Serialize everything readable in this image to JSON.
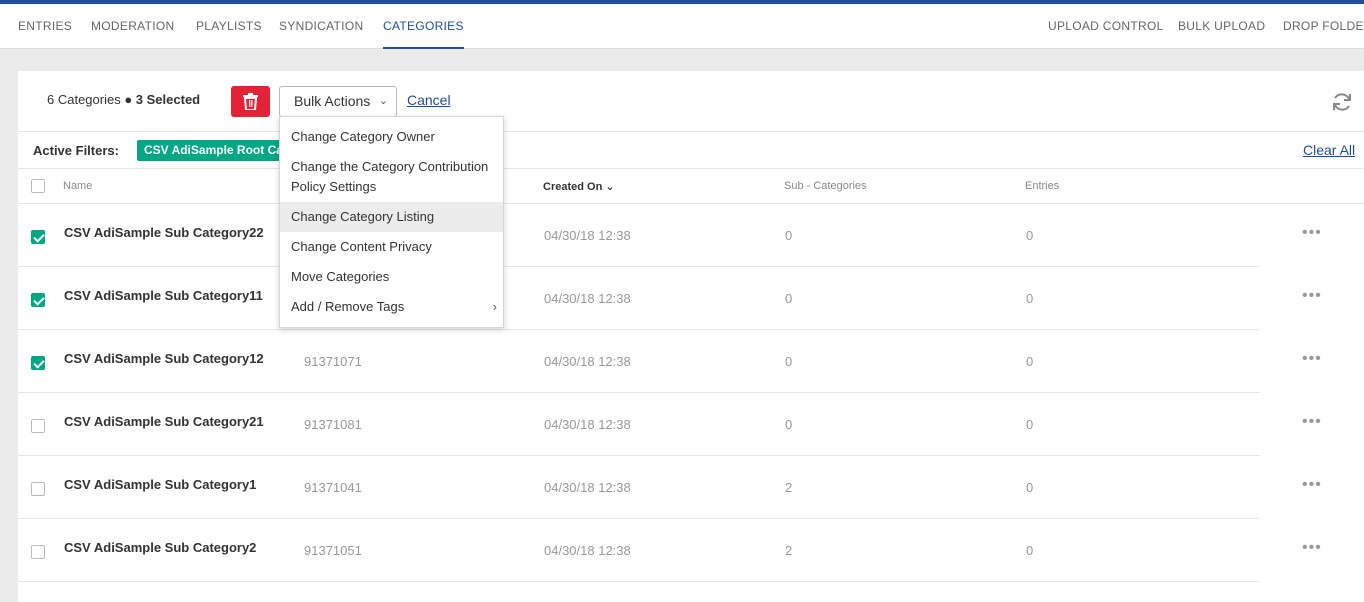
{
  "nav": {
    "left": [
      "ENTRIES",
      "MODERATION",
      "PLAYLISTS",
      "SYNDICATION",
      "CATEGORIES"
    ],
    "right": [
      "UPLOAD CONTROL",
      "BULK UPLOAD",
      "DROP FOLDERS"
    ],
    "active": "CATEGORIES"
  },
  "toolbar": {
    "count_prefix": "6 Categories",
    "count_selected": "3 Selected",
    "bulk_label": "Bulk Actions",
    "cancel_label": "Cancel"
  },
  "filters": {
    "label": "Active Filters:",
    "chip": "CSV AdiSample Root Category",
    "clear_all": "Clear All"
  },
  "table": {
    "headers": {
      "name": "Name",
      "created": "Created On",
      "sub": "Sub - Categories",
      "entries": "Entries"
    },
    "rows": [
      {
        "name": "CSV AdiSample Sub Category22",
        "id": "",
        "created": "04/30/18 12:38",
        "sub": "0",
        "entries": "0",
        "checked": true
      },
      {
        "name": "CSV AdiSample Sub Category11",
        "id": "",
        "created": "04/30/18 12:38",
        "sub": "0",
        "entries": "0",
        "checked": true
      },
      {
        "name": "CSV AdiSample Sub Category12",
        "id": "91371071",
        "created": "04/30/18 12:38",
        "sub": "0",
        "entries": "0",
        "checked": true
      },
      {
        "name": "CSV AdiSample Sub Category21",
        "id": "91371081",
        "created": "04/30/18 12:38",
        "sub": "0",
        "entries": "0",
        "checked": false
      },
      {
        "name": "CSV AdiSample Sub Category1",
        "id": "91371041",
        "created": "04/30/18 12:38",
        "sub": "2",
        "entries": "0",
        "checked": false
      },
      {
        "name": "CSV AdiSample Sub Category2",
        "id": "91371051",
        "created": "04/30/18 12:38",
        "sub": "2",
        "entries": "0",
        "checked": false
      }
    ]
  },
  "bulk_menu": {
    "items": [
      "Change Category Owner",
      "Change the Category Contribution Policy Settings",
      "Change Category Listing",
      "Change Content Privacy",
      "Move Categories",
      "Add / Remove Tags"
    ],
    "highlighted": "Change Category Listing",
    "submenu_item": "Add / Remove Tags"
  },
  "colors": {
    "accent": "#1f4e9c",
    "delete": "#e12237",
    "check": "#00a784"
  }
}
